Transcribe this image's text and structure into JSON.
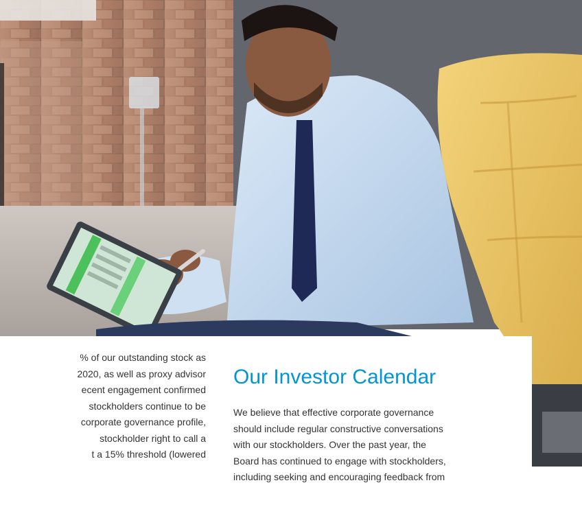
{
  "left_column": {
    "lines": [
      "% of our outstanding stock as",
      "2020, as well as proxy advisor",
      "ecent engagement confirmed",
      "stockholders continue to be",
      "corporate governance profile,",
      "stockholder right to call a",
      "t a 15% threshold (lowered"
    ]
  },
  "right_column": {
    "heading": "Our Investor Calendar",
    "lines": [
      "We believe that effective corporate governance",
      "should include regular constructive conversations",
      "with our stockholders. Over the past year, the",
      "Board has continued to engage with stockholders,",
      "including seeking and encouraging feedback from"
    ]
  },
  "colors": {
    "heading": "#0096d6",
    "body_text": "#333333",
    "panel": "#ffffff"
  }
}
